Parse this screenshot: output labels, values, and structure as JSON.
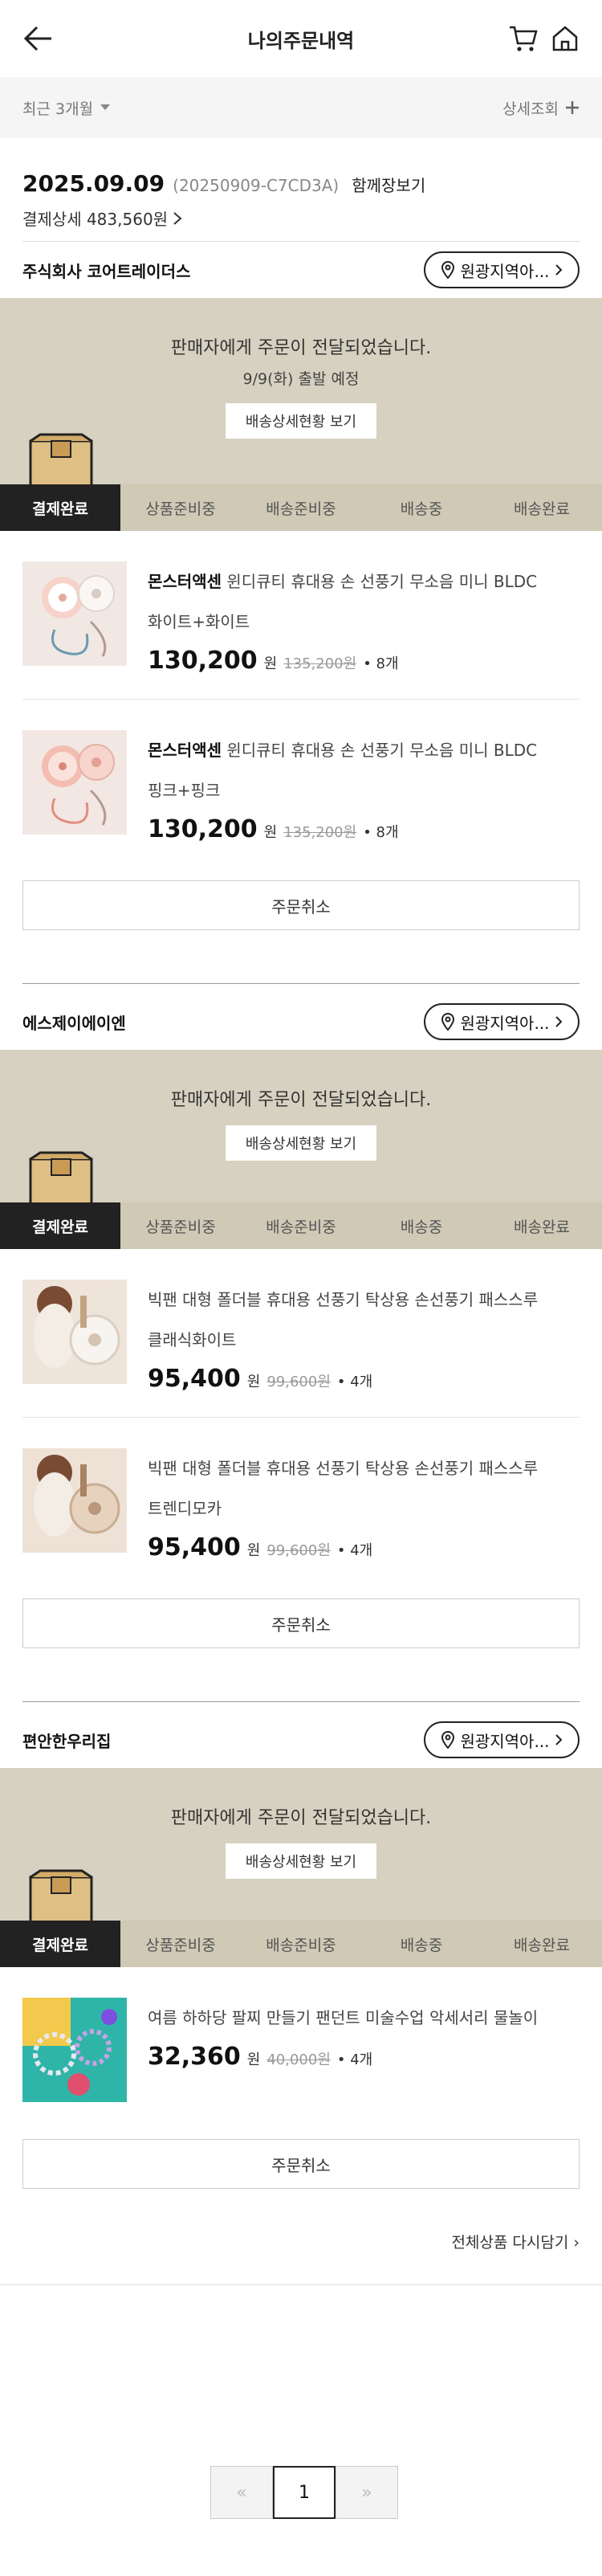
{
  "header": {
    "title": "나의주문내역"
  },
  "filter": {
    "period": "최근 3개월",
    "detail_search": "상세조회"
  },
  "order": {
    "date": "2025.09.09",
    "order_no": "(20250909-C7CD3A)",
    "gift_link": "함께장보기",
    "pay_detail": "결제상세 483,560원"
  },
  "steps": [
    "결제완료",
    "상품준비중",
    "배송준비중",
    "배송중",
    "배송완료"
  ],
  "sellers": [
    {
      "name": "주식회사 코어트레이더스",
      "region_label": "원광지역아...",
      "banner_msg": "판매자에게 주문이 전달되었습니다.",
      "banner_sub": "9/9(화) 출발 예정",
      "track_label": "배송상세현황 보기",
      "cancel_label": "주문취소",
      "items": [
        {
          "brand": "몬스터액센",
          "name": "윈디큐티 휴대용 손 선풍기 무소음 미니 BLDC",
          "option": "화이트+화이트",
          "price": "130,200",
          "won": "원",
          "orig": "135,200원",
          "qty": "• 8개"
        },
        {
          "brand": "몬스터액센",
          "name": "윈디큐티 휴대용 손 선풍기 무소음 미니 BLDC",
          "option": "핑크+핑크",
          "price": "130,200",
          "won": "원",
          "orig": "135,200원",
          "qty": "• 8개"
        }
      ]
    },
    {
      "name": "에스제이에이엔",
      "region_label": "원광지역아...",
      "banner_msg": "판매자에게 주문이 전달되었습니다.",
      "track_label": "배송상세현황 보기",
      "cancel_label": "주문취소",
      "items": [
        {
          "name": "빅팬 대형 폴더블 휴대용 선풍기 탁상용 손선풍기 패스스루",
          "option": "클래식화이트",
          "price": "95,400",
          "won": "원",
          "orig": "99,600원",
          "qty": "• 4개"
        },
        {
          "name": "빅팬 대형 폴더블 휴대용 선풍기 탁상용 손선풍기 패스스루",
          "option": "트렌디모카",
          "price": "95,400",
          "won": "원",
          "orig": "99,600원",
          "qty": "• 4개"
        }
      ]
    },
    {
      "name": "편안한우리집",
      "region_label": "원광지역아...",
      "banner_msg": "판매자에게 주문이 전달되었습니다.",
      "track_label": "배송상세현황 보기",
      "cancel_label": "주문취소",
      "items": [
        {
          "name": "여름 하하당 팔찌 만들기 팬던트 미술수업 악세서리 물놀이",
          "price": "32,360",
          "won": "원",
          "orig": "40,000원",
          "qty": "• 4개"
        }
      ]
    }
  ],
  "rebuy": "전체상품 다시담기",
  "pager": {
    "current": "1",
    "prev": "«",
    "next": "»"
  },
  "colors": {
    "banner": "#d6d1c0",
    "step_active": "#222222"
  }
}
